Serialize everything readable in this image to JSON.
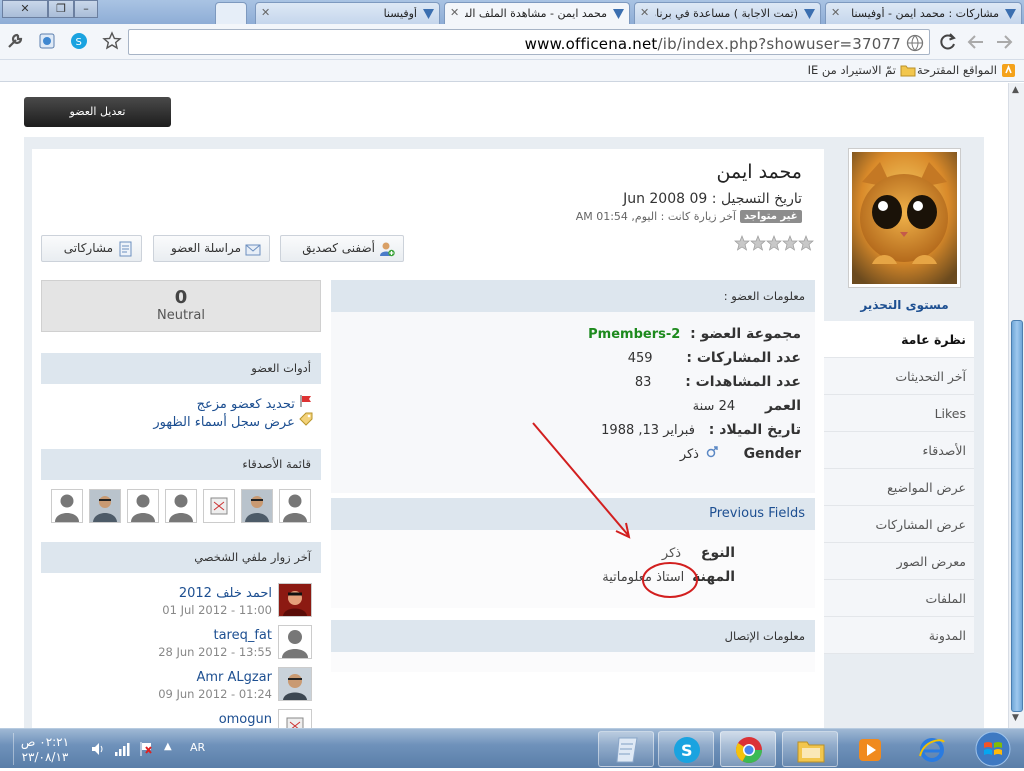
{
  "browser": {
    "tabs": [
      {
        "title": "مشاركات : محمد ايمن - أوفيسنا"
      },
      {
        "title": "(تمت الاجابة ) مساعدة في برنامج"
      },
      {
        "title": "محمد ايمن - مشاهدة الملف الشخصي"
      },
      {
        "title": "أوفيسنا"
      }
    ],
    "url_domain": "www.officena.net",
    "url_rest": "/ib/index.php?showuser=37077",
    "bookmarks": [
      {
        "label": "المواقع المقترحة"
      },
      {
        "label": "تمّ الاستيراد من IE"
      }
    ]
  },
  "page": {
    "edit_button": "تعديل العضو",
    "profile_name": "محمد ايمن",
    "registered": "تاريخ التسجيل : 09 Jun 2008",
    "status_badge": "غير متواجد",
    "last_visit": "آخر زيارة كانت : اليوم, 01:54 AM",
    "actions": {
      "add_friend": "أضفنى كصديق",
      "message": "مراسلة العضو",
      "posts": "مشاركاتى"
    },
    "warn_level": "مستوى التحذير",
    "nav": [
      {
        "label": "نظرة عامة",
        "active": true
      },
      {
        "label": "آخر التحديثات"
      },
      {
        "label": "Likes"
      },
      {
        "label": "الأصدقاء"
      },
      {
        "label": "عرض المواضيع"
      },
      {
        "label": "عرض المشاركات"
      },
      {
        "label": "معرض الصور"
      },
      {
        "label": "الملفات"
      },
      {
        "label": "المدونة"
      }
    ],
    "reputation": {
      "value": "0",
      "label": "Neutral"
    },
    "member_tools": {
      "title": "أدوات العضو",
      "items": [
        "تحديد كعضو مزعج",
        "عرض سجل أسماء الظهور"
      ]
    },
    "friends": {
      "title": "قائمة الأصدقاء"
    },
    "visitors": {
      "title": "آخر زوار ملفي الشخصي",
      "items": [
        {
          "name": "احمد خلف 2012",
          "date": "01 Jul 2012 - 11:00"
        },
        {
          "name": "tareq_fat",
          "date": "28 Jun 2012 - 13:55"
        },
        {
          "name": "Amr ALgzar",
          "date": "09 Jun 2012 - 01:24"
        },
        {
          "name": "omogun",
          "date": ""
        }
      ]
    },
    "member_info": {
      "title": "معلومات العضو :",
      "rows": [
        {
          "label": "مجموعة العضو :",
          "value": "Pmembers-2"
        },
        {
          "label": "عدد المشاركات :",
          "value": "459"
        },
        {
          "label": "عدد المشاهدات :",
          "value": "83"
        },
        {
          "label": "العمر",
          "value": "24 سنة"
        },
        {
          "label": "تاريخ الميلاد :",
          "value": "فبراير 13, 1988"
        },
        {
          "label": "Gender",
          "value": "ذكر"
        }
      ]
    },
    "previous_fields": {
      "title": "Previous Fields",
      "rows": [
        {
          "label": "النوع",
          "value": "ذكر"
        },
        {
          "label": "المهنة",
          "value": "استاذ معلوماتية"
        }
      ]
    },
    "contact": {
      "title": "معلومات الإتصال"
    }
  },
  "taskbar": {
    "lang": "AR",
    "time": "٠٢:٢١ ص",
    "date": "٢٣/٠٨/١٣"
  },
  "colors": {
    "accent_red": "#d21f1f",
    "group_green": "#1d8a1d",
    "link_blue": "#1d4f91"
  }
}
